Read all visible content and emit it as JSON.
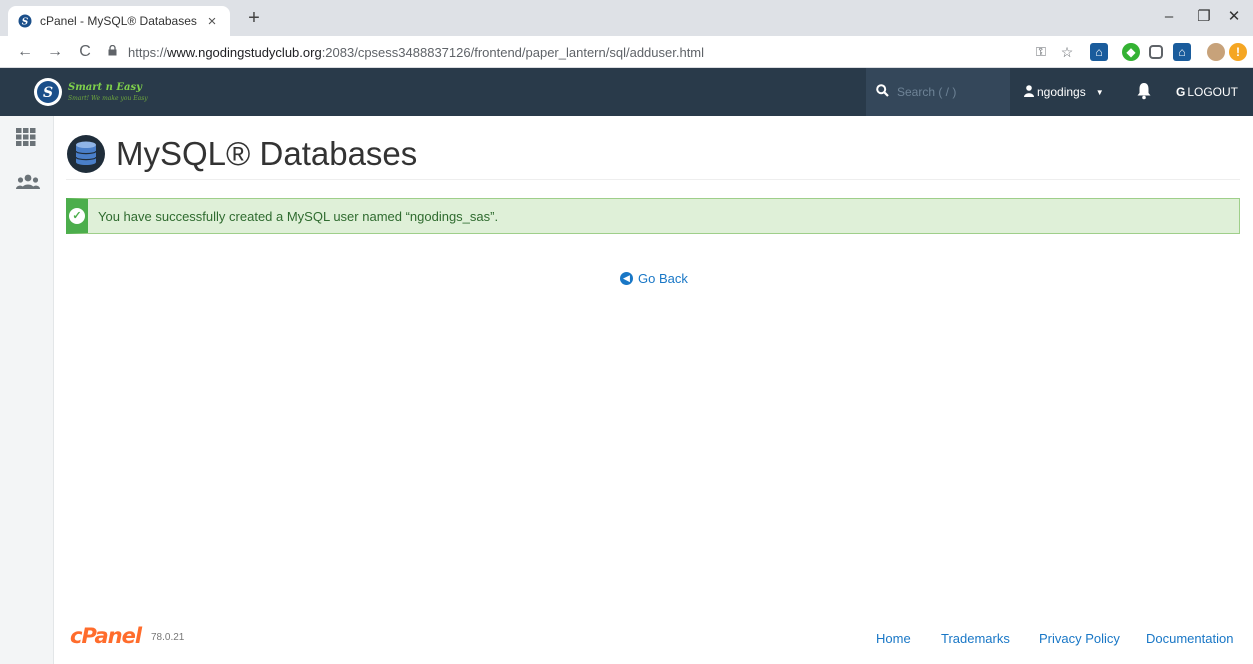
{
  "browser": {
    "tab_title": "cPanel - MySQL® Databases",
    "tab_close": "×",
    "new_tab": "+",
    "url_prefix": "https://",
    "url_host": "www.ngodingstudyclub.org",
    "url_path": ":2083/cpsess3488837126/frontend/paper_lantern/sql/adduser.html",
    "window_controls": {
      "minimize": "–",
      "restore": "❐",
      "close": "✕"
    }
  },
  "topnav": {
    "logo_title": "Smart n Easy",
    "logo_tagline": "Smart! We make you Easy",
    "search_placeholder": "Search ( / )",
    "username": "ngodings",
    "logout_label": "LOGOUT"
  },
  "page": {
    "title": "MySQL® Databases",
    "alert_message": "You have successfully created a MySQL user named “ngodings_sas”.",
    "go_back_label": "Go Back"
  },
  "footer": {
    "brand": "cPanel",
    "version": "78.0.21",
    "links": {
      "home": "Home",
      "trademarks": "Trademarks",
      "privacy": "Privacy Policy",
      "documentation": "Documentation"
    }
  },
  "colors": {
    "topnav_bg": "#293a4a",
    "alert_bg": "#dff0d8",
    "alert_accent": "#4cae4c",
    "link": "#1977c6",
    "cpanel_orange": "#ff6c2c"
  }
}
